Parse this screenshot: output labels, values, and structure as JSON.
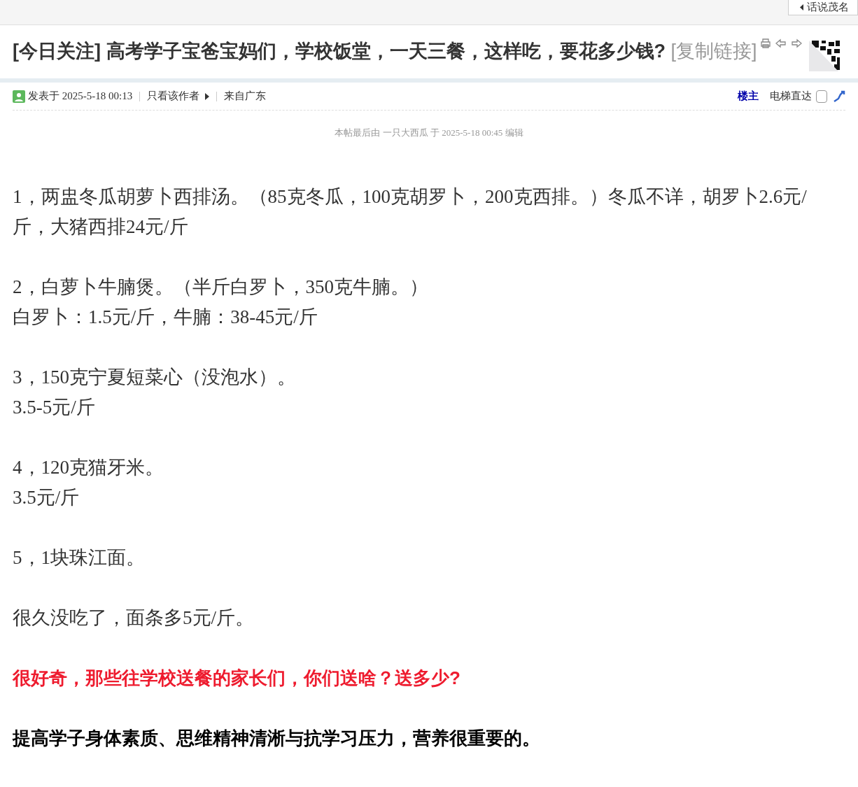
{
  "top_tab": {
    "label": "话说茂名"
  },
  "thread": {
    "tag": "[今日关注]",
    "title": "高考学子宝爸宝妈们，学校饭堂，一天三餐，这样吃，要花多少钱?",
    "copy_link": "[复制链接]"
  },
  "post_meta": {
    "posted": "发表于 2025-5-18 00:13",
    "author_only": "只看该作者",
    "location": "来自广东",
    "floor": "楼主",
    "jump_label": "电梯直达",
    "jump_checked": false
  },
  "edit_note": "本帖最后由 一只大西瓜 于 2025-5-18 00:45 编辑",
  "paragraphs": [
    {
      "kind": "plain",
      "lines": [
        "1，两盅冬瓜胡萝卜西排汤。（85克冬瓜，100克胡罗卜，200克西排。）冬瓜不详，胡罗卜2.6元/斤，大猪西排24元/斤"
      ]
    },
    {
      "kind": "plain",
      "lines": [
        "2，白萝卜牛腩煲。（半斤白罗卜，350克牛腩。）",
        "白罗卜：1.5元/斤，牛腩：38-45元/斤"
      ]
    },
    {
      "kind": "plain",
      "lines": [
        "3，150克宁夏短菜心（没泡水）。",
        "3.5-5元/斤"
      ]
    },
    {
      "kind": "plain",
      "lines": [
        "4，120克猫牙米。",
        "3.5元/斤"
      ]
    },
    {
      "kind": "plain",
      "lines": [
        "5，1块珠江面。"
      ]
    },
    {
      "kind": "plain",
      "lines": [
        "很久没吃了，面条多5元/斤。"
      ]
    },
    {
      "kind": "red",
      "lines": [
        "很好奇，那些往学校送餐的家长们，你们送啥？送多少?"
      ]
    },
    {
      "kind": "bold",
      "lines": [
        "提高学子身体素质、思维精神清淅与抗学习压力，营养很重要的。"
      ]
    }
  ]
}
